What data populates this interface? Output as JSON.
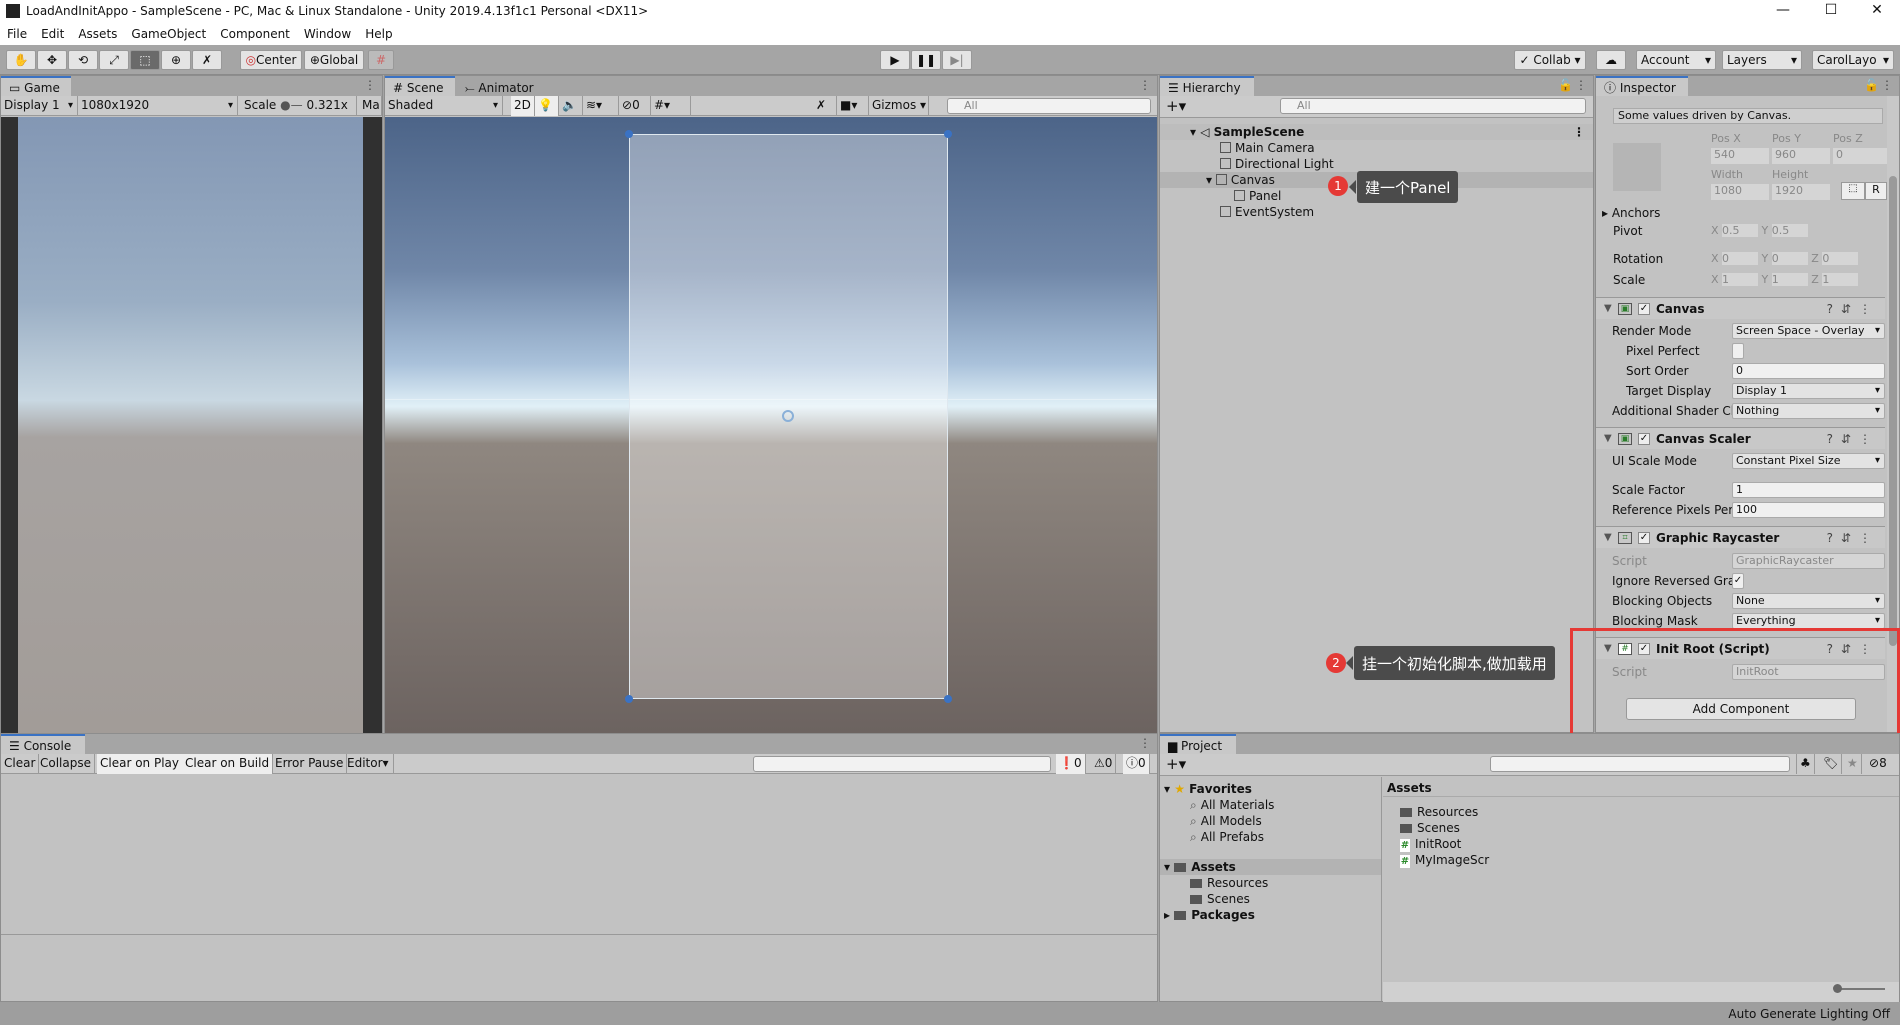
{
  "window": {
    "title": "LoadAndInitAppo - SampleScene - PC, Mac & Linux Standalone - Unity 2019.4.13f1c1 Personal <DX11>",
    "minimize": "—",
    "maximize": "☐",
    "close": "✕"
  },
  "menu": [
    "File",
    "Edit",
    "Assets",
    "GameObject",
    "Component",
    "Window",
    "Help"
  ],
  "toolbar": {
    "center": "Center",
    "global": "Global",
    "collab": "Collab",
    "account": "Account",
    "layers": "Layers",
    "layout": "CarolLayo"
  },
  "game": {
    "tab": "Game",
    "display": "Display 1",
    "resolution": "1080x1920",
    "scale_label": "Scale",
    "scale_value": "0.321x",
    "maximize": "Ma"
  },
  "scene": {
    "tab": "Scene",
    "tab2": "Animator",
    "shading": "Shaded",
    "mode2d": "2D",
    "hidden_count": "0",
    "gizmos": "Gizmos",
    "search_placeholder": "All"
  },
  "hierarchy": {
    "tab": "Hierarchy",
    "search_placeholder": "All",
    "scene": "SampleScene",
    "items": [
      "Main Camera",
      "Directional Light",
      "Canvas",
      "Panel",
      "EventSystem"
    ]
  },
  "annotations": {
    "n1": "1",
    "text1": "建一个Panel",
    "n2": "2",
    "text2": "挂一个初始化脚本,做加载用"
  },
  "inspector": {
    "tab": "Inspector",
    "note": "Some values driven by Canvas.",
    "rect": {
      "posx_label": "Pos X",
      "posy_label": "Pos Y",
      "posz_label": "Pos Z",
      "posx": "540",
      "posy": "960",
      "posz": "0",
      "width_label": "Width",
      "height_label": "Height",
      "width": "1080",
      "height": "1920",
      "r": "R",
      "anchors": "Anchors",
      "pivot": "Pivot",
      "pivot_x": "0.5",
      "pivot_y": "0.5",
      "rotation": "Rotation",
      "rot_x": "0",
      "rot_y": "0",
      "rot_z": "0",
      "scale": "Scale",
      "scale_x": "1",
      "scale_y": "1",
      "scale_z": "1",
      "x": "X",
      "y": "Y",
      "z": "Z"
    },
    "canvas": {
      "title": "Canvas",
      "rows": [
        [
          "Render Mode",
          "Screen Space - Overlay"
        ],
        [
          "Pixel Perfect",
          ""
        ],
        [
          "Sort Order",
          "0"
        ],
        [
          "Target Display",
          "Display 1"
        ],
        [
          "Additional Shader Ch",
          "Nothing"
        ]
      ]
    },
    "scaler": {
      "title": "Canvas Scaler",
      "rows": [
        [
          "UI Scale Mode",
          "Constant Pixel Size"
        ],
        [
          "Scale Factor",
          "1"
        ],
        [
          "Reference Pixels Per",
          "100"
        ]
      ]
    },
    "raycaster": {
      "title": "Graphic Raycaster",
      "rows": [
        [
          "Script",
          "GraphicRaycaster"
        ],
        [
          "Ignore Reversed Grap",
          "✓"
        ],
        [
          "Blocking Objects",
          "None"
        ],
        [
          "Blocking Mask",
          "Everything"
        ]
      ]
    },
    "initroot": {
      "title": "Init Root (Script)",
      "script_label": "Script",
      "script": "InitRoot"
    },
    "add_component": "Add Component"
  },
  "console": {
    "tab": "Console",
    "buttons": [
      "Clear",
      "Collapse",
      "Clear on Play",
      "Clear on Build",
      "Error Pause",
      "Editor"
    ],
    "errors": "0",
    "warnings": "0",
    "infos": "0"
  },
  "project": {
    "tab": "Project",
    "hidden_count": "8",
    "favorites": "Favorites",
    "fav_items": [
      "All Materials",
      "All Models",
      "All Prefabs"
    ],
    "assets": "Assets",
    "asset_folders": [
      "Resources",
      "Scenes"
    ],
    "packages": "Packages",
    "right_header": "Assets",
    "right_items": [
      {
        "name": "Resources",
        "type": "folder"
      },
      {
        "name": "Scenes",
        "type": "folder"
      },
      {
        "name": "InitRoot",
        "type": "script"
      },
      {
        "name": "MyImageScr",
        "type": "script"
      }
    ]
  },
  "status": {
    "text": "Auto Generate Lighting Off"
  },
  "colors": {
    "accent": "#3a72c4",
    "highlight_box": "#e53935",
    "selection": "#b3b3b3"
  }
}
